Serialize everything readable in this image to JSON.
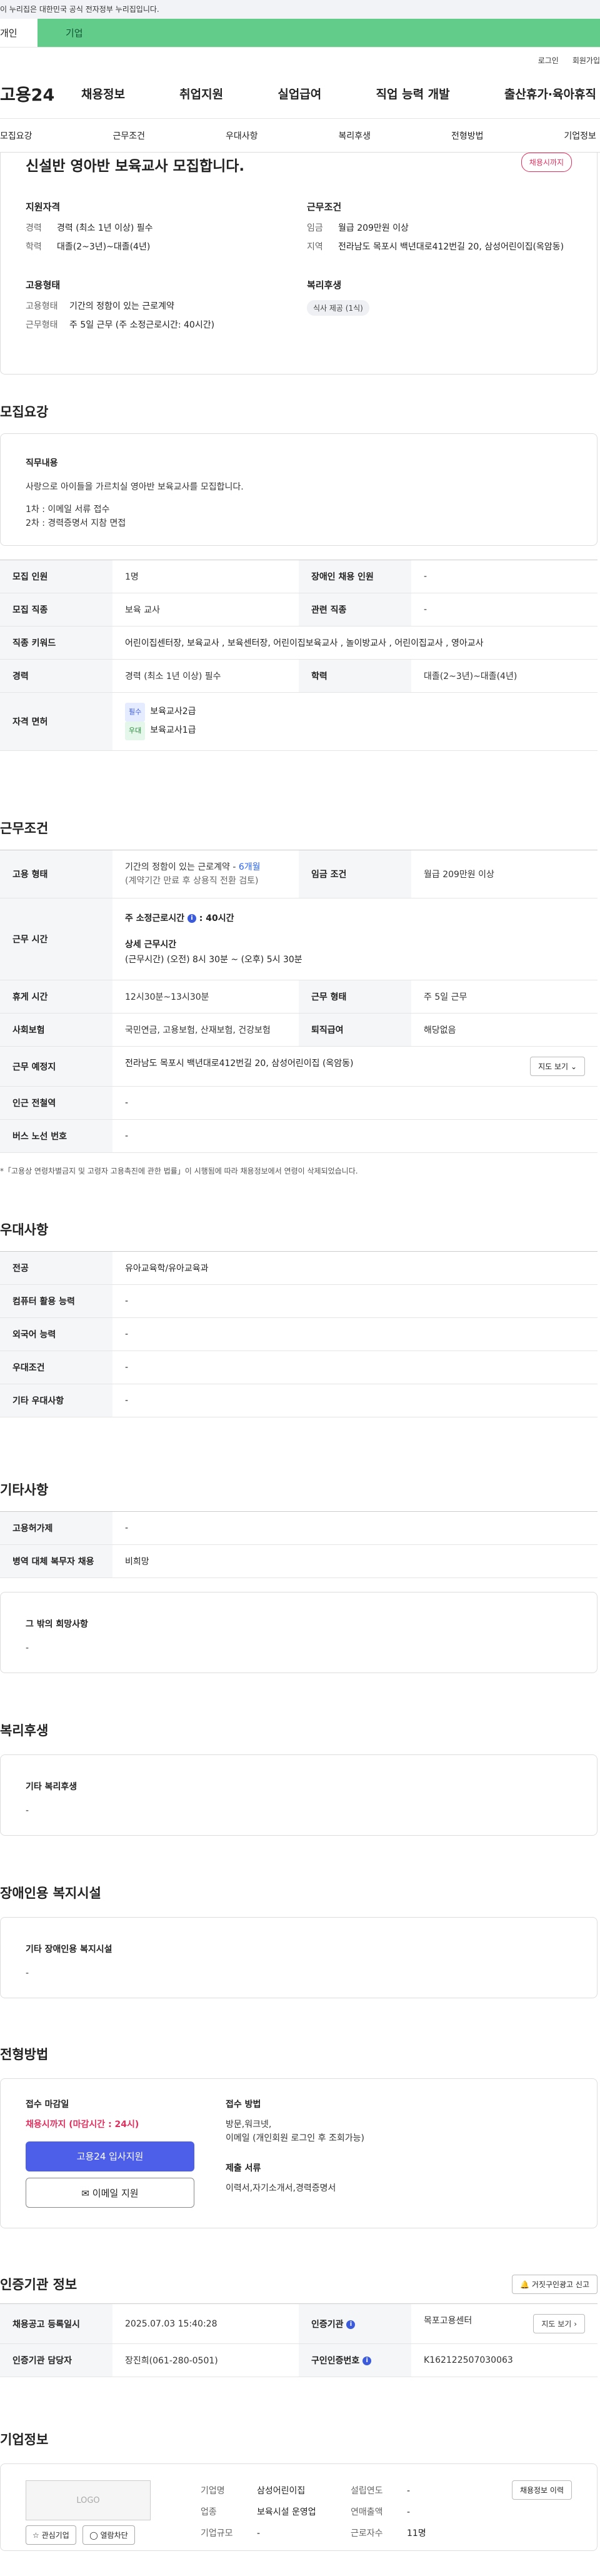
{
  "gov_bar": "이 누리집은 대한민국 공식 전자정부 누리집입니다.",
  "tabs": [
    "개인",
    "기업"
  ],
  "util": [
    "로그인",
    "회원가입"
  ],
  "gnb": {
    "logo": "고용24",
    "menu": [
      "채용정보",
      "취업지원",
      "실업급여",
      "직업 능력 개발",
      "출산휴가·육아휴직"
    ]
  },
  "subnav": [
    "모집요강",
    "근무조건",
    "우대사항",
    "복리후생",
    "전형방법",
    "기업정보"
  ],
  "summary": {
    "title": "신설반 영아반 보육교사 모집합니다.",
    "deadline_badge": "채용시까지",
    "qual_title": "지원자격",
    "qual": [
      {
        "k": "경력",
        "v": "경력 (최소 1년 이상) 필수"
      },
      {
        "k": "학력",
        "v": "대졸(2~3년)~대졸(4년)"
      }
    ],
    "work_title": "근무조건",
    "work": [
      {
        "k": "임금",
        "v": "월급 209만원 이상"
      },
      {
        "k": "지역",
        "v": "전라남도 목포시 백년대로412번길 20, 삼성어린이집(옥암동)"
      }
    ],
    "emp_title": "고용형태",
    "emp": [
      {
        "k": "고용형태",
        "v": "기간의 정함이 있는 근로계약"
      },
      {
        "k": "근무형태",
        "v": "주 5일 근무 (주 소정근로시간: 40시간)"
      }
    ],
    "welfare_title": "복리후생",
    "welfare_chip": "식사 제공 (1식)"
  },
  "recruit": {
    "title": "모집요강",
    "duty_title": "직무내용",
    "duty_lines": [
      "사랑으로 아이들을 가르치실 영아반 보육교사를 모집합니다.",
      "",
      "1차 : 이메일 서류 접수",
      "2차 : 경력증명서 지참 면접"
    ],
    "rows": [
      [
        "모집 인원",
        "1명",
        "장애인 채용 인원",
        "-"
      ],
      [
        "모집 직종",
        "보육 교사",
        "관련 직종",
        "-"
      ],
      [
        "경력",
        "경력 (최소 1년 이상) 필수",
        "학력",
        "대졸(2~3년)~대졸(4년)"
      ]
    ],
    "keyword_label": "직종 키워드",
    "keywords": "어린이집센터장, 보육교사 , 보육센터장, 어린이집보육교사 , 놀이방교사 , 어린이집교사 , 영아교사",
    "license_label": "자격 면허",
    "license_req_tag": "필수",
    "license_req": "보육교사2급",
    "license_pref_tag": "우대",
    "license_pref": "보육교사1급"
  },
  "work": {
    "title": "근무조건",
    "type_label": "고용 형태",
    "type_v1": "기간의 정함이 있는 근로계약 -",
    "type_v1b": "6개월",
    "type_v2": "(계약기간 만료 후 상용직 전환 검토)",
    "wage_label": "임금 조건",
    "wage": "월급 209만원 이상",
    "time_label": "근무 시간",
    "time_weekly": "주 소정근로시간",
    "time_weekly_v": ": 40시간",
    "time_detail_title": "상세 근무시간",
    "time_detail": "(근무시간) (오전) 8시 30분 ~ (오후) 5시 30분",
    "rows": [
      [
        "휴게 시간",
        "12시30분~13시30분",
        "근무 형태",
        "주 5일 근무"
      ],
      [
        "사회보험",
        "국민연금, 고용보험, 산재보험, 건강보험",
        "퇴직급여",
        "해당없음"
      ]
    ],
    "place_label": "근무 예정지",
    "place": "전라남도 목포시 백년대로412번길 20, 삼성어린이집 (옥암동)",
    "map_btn": "지도 보기",
    "station_label": "인근 전철역",
    "station": "-",
    "bus_label": "버스 노선 번호",
    "bus": "-",
    "note": "*「고용상 연령차별금지 및 고령자 고용촉진에 관한 법률」이 시행됨에 따라 채용정보에서 연령이 삭제되었습니다."
  },
  "pref": {
    "title": "우대사항",
    "rows": [
      [
        "전공",
        "유아교육학/유아교육과"
      ],
      [
        "컴퓨터 활용 능력",
        "-"
      ],
      [
        "외국어 능력",
        "-"
      ],
      [
        "우대조건",
        "-"
      ],
      [
        "기타 우대사항",
        "-"
      ]
    ]
  },
  "etc": {
    "title": "기타사항",
    "rows": [
      [
        "고용허가제",
        "-"
      ],
      [
        "병역 대체 복무자 채용",
        "비희망"
      ]
    ],
    "box_title": "그 밖의 희망사항",
    "box_value": "-"
  },
  "welfare": {
    "title": "복리후생",
    "box_title": "기타 복리후생",
    "box_value": "-"
  },
  "disabled": {
    "title": "장애인용 복지시설",
    "box_title": "기타 장애인용 복지시설",
    "box_value": "-"
  },
  "screening": {
    "title": "전형방법",
    "deadline_title": "접수 마감일",
    "deadline": "채용시까지 (마감시간 : 24시)",
    "apply_btn": "고용24 입사지원",
    "email_btn": "이메일 지원",
    "method_title": "접수 방법",
    "method": [
      "방문,워크넷,",
      "이메일 (개인회원 로그인 후 조회가능)"
    ],
    "docs_title": "제출 서류",
    "docs": "이력서,자기소개서,경력증명서"
  },
  "cert": {
    "title": "인증기관 정보",
    "report_btn": "거짓구인광고 신고",
    "rows": [
      [
        "채용공고 등록일시",
        "2025.07.03 15:40:28",
        "인증기관",
        "목포고용센터"
      ],
      [
        "인증기관 담당자",
        "장진희(061-280-0501)",
        "구인인증번호",
        "K162122507030063"
      ]
    ],
    "map_btn": "지도 보기"
  },
  "company": {
    "title": "기업정보",
    "logo": "LOGO",
    "fav_btn": "관심기업",
    "block_btn": "열람차단",
    "history_btn": "채용정보 이력",
    "fields": [
      [
        "기업명",
        "삼성어린이집",
        "설립연도",
        "-"
      ],
      [
        "업종",
        "보육시설 운영업",
        "연매출액",
        "-"
      ],
      [
        "기업규모",
        "-",
        "근로자수",
        "11명"
      ]
    ]
  }
}
